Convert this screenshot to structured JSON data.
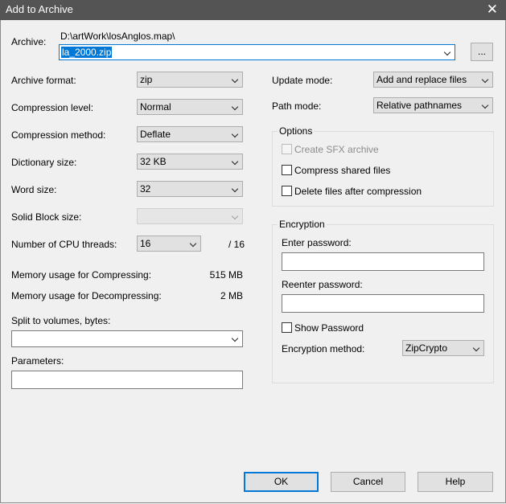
{
  "window": {
    "title": "Add to Archive",
    "close_icon": "close-icon"
  },
  "archive": {
    "label": "Archive:",
    "path": "D:\\artWork\\losAnglos.map\\",
    "filename": "la_2000.zip",
    "browse_label": "..."
  },
  "left": {
    "format": {
      "label": "Archive format:",
      "value": "zip"
    },
    "level": {
      "label": "Compression level:",
      "value": "Normal"
    },
    "method": {
      "label": "Compression method:",
      "value": "Deflate"
    },
    "dict": {
      "label": "Dictionary size:",
      "value": "32 KB"
    },
    "word": {
      "label": "Word size:",
      "value": "32"
    },
    "solid": {
      "label": "Solid Block size:",
      "value": ""
    },
    "threads": {
      "label": "Number of CPU threads:",
      "value": "16",
      "max": "/ 16"
    },
    "mem_comp": {
      "label": "Memory usage for Compressing:",
      "value": "515 MB"
    },
    "mem_decomp": {
      "label": "Memory usage for Decompressing:",
      "value": "2 MB"
    },
    "split": {
      "label": "Split to volumes, bytes:",
      "value": ""
    },
    "params": {
      "label": "Parameters:",
      "value": ""
    }
  },
  "right": {
    "update": {
      "label": "Update mode:",
      "value": "Add and replace files"
    },
    "path": {
      "label": "Path mode:",
      "value": "Relative pathnames"
    },
    "options": {
      "title": "Options",
      "sfx": "Create SFX archive",
      "shared": "Compress shared files",
      "delete": "Delete files after compression"
    },
    "encryption": {
      "title": "Encryption",
      "enter": "Enter password:",
      "reenter": "Reenter password:",
      "show": "Show Password",
      "method_label": "Encryption method:",
      "method_value": "ZipCrypto"
    }
  },
  "buttons": {
    "ok": "OK",
    "cancel": "Cancel",
    "help": "Help"
  },
  "colors": {
    "titlebar": "#545454",
    "accent": "#0078d7",
    "dialog_bg": "#f0f0f0"
  }
}
